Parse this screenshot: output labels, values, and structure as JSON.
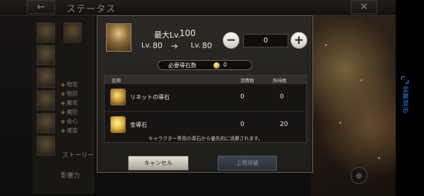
{
  "screen": {
    "title": "ステータス",
    "back_icon": "←",
    "close_icon": "✕",
    "story_label": "ストーリー",
    "influence_label": "影響力",
    "zoom_icon": "⊕",
    "stats": [
      "物攻",
      "物防",
      "魔攻",
      "魔防",
      "会心",
      "速度"
    ]
  },
  "modal": {
    "max_level_label": "最大Lv.",
    "max_level_value": "100",
    "from_label": "Lv.",
    "from_value": "80",
    "to_label": "Lv.",
    "to_value": "80",
    "stepper_value": "0",
    "minus_label": "−",
    "plus_label": "+",
    "required_label": "必要導石数",
    "required_value": "0",
    "table": {
      "headers": [
        "名称",
        "消費数",
        "所持数"
      ],
      "rows": [
        {
          "name": "リネットの導石",
          "used": "0",
          "owned": "0"
        },
        {
          "name": "金導石",
          "used": "0",
          "owned": "20"
        }
      ]
    },
    "note": "キャラクター専用の導石から優先的に消費されます。",
    "cancel_label": "キャンセル",
    "breakthrough_label": "上限突破"
  },
  "system": {
    "fullscreen_label": "全屏显示"
  },
  "colors": {
    "accent_blue": "#3a89ff",
    "gold": "#c89a22",
    "disabled_button": "#2a3037"
  }
}
